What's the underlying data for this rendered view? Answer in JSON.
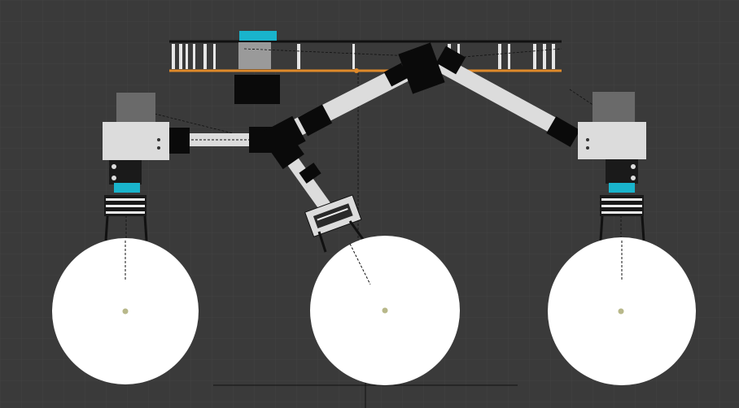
{
  "viewport": {
    "colors": {
      "background": "#3a3a3a",
      "grid": "#444444",
      "body": "#dcdcdc",
      "motor_top": "#6a6a6a",
      "joint": "#0a0a0a",
      "accent_cyan": "#19b4cc",
      "rail_orange": "#e08a2a",
      "wheel": "#ffffff",
      "hub": "#b8b88a"
    }
  }
}
